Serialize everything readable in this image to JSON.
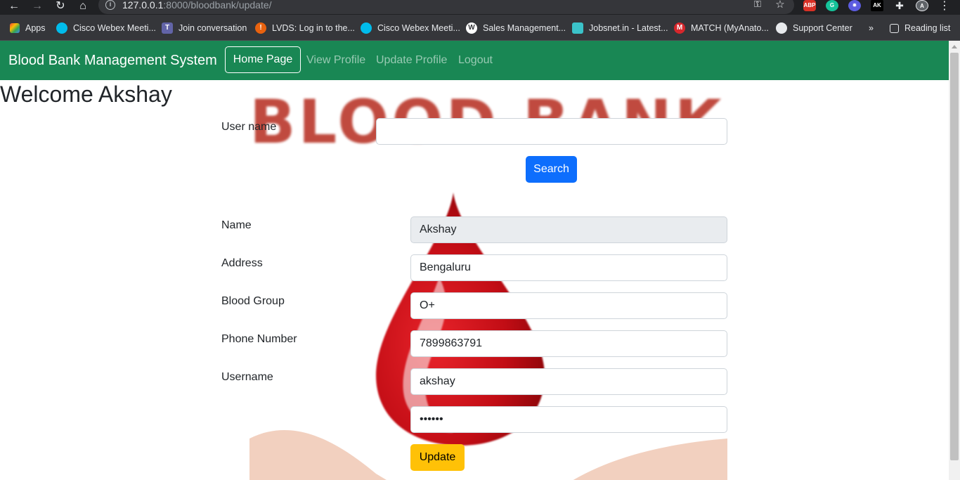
{
  "browser": {
    "url_host": "127.0.0.1",
    "url_path": ":8000/bloodbank/update/",
    "bookmarks": [
      {
        "label": "Apps"
      },
      {
        "label": "Cisco Webex Meeti..."
      },
      {
        "label": "Join conversation"
      },
      {
        "label": "LVDS: Log in to the..."
      },
      {
        "label": "Cisco Webex Meeti..."
      },
      {
        "label": "Sales Management..."
      },
      {
        "label": "Jobsnet.in - Latest..."
      },
      {
        "label": "MATCH (MyAnato..."
      },
      {
        "label": "Support Center"
      }
    ],
    "overflow_label": "»",
    "reading_list_label": "Reading list",
    "extension_labels": {
      "abp": "ABP",
      "ak": "AK"
    }
  },
  "navbar": {
    "brand": "Blood Bank Management System",
    "home": "Home Page",
    "view_profile": "View Profile",
    "update_profile": "Update Profile",
    "logout": "Logout",
    "bg_color": "#198754"
  },
  "page": {
    "welcome": "Welcome Akshay",
    "background_title": "BLOOD BANK"
  },
  "search": {
    "label": "User name",
    "value": "",
    "button": "Search"
  },
  "form": {
    "name_label": "Name",
    "name_value": "Akshay",
    "address_label": "Address",
    "address_value": "Bengaluru",
    "blood_group_label": "Blood Group",
    "blood_group_value": "O+",
    "phone_label": "Phone Number",
    "phone_value": "7899863791",
    "username_label": "Username",
    "username_value": "akshay",
    "password_value": "••••••",
    "update_button": "Update"
  },
  "colors": {
    "primary": "#0d6efd",
    "warning": "#ffc107",
    "success": "#198754"
  }
}
